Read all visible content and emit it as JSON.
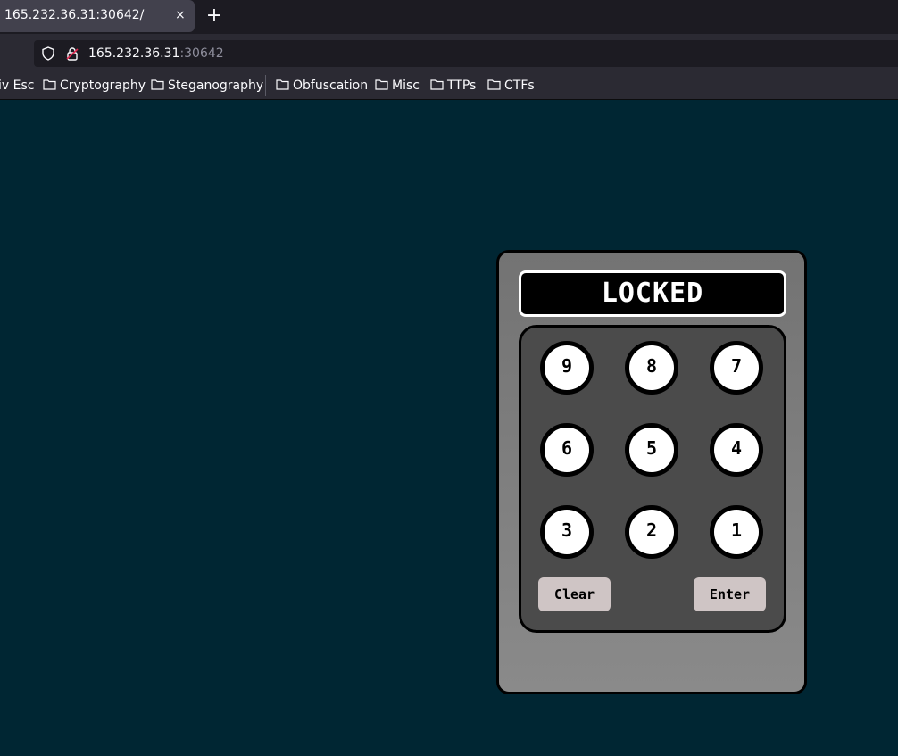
{
  "browser": {
    "tab": {
      "title": "165.232.36.31:30642/",
      "close_glyph": "×"
    },
    "new_tab_glyph": "+",
    "url": {
      "host": "165.232.36.31",
      "port": ":30642"
    },
    "bookmarks": [
      {
        "label": "iv Esc"
      },
      {
        "label": "Cryptography"
      },
      {
        "label": "Steganography"
      },
      {
        "label": "Obfuscation"
      },
      {
        "label": "Misc"
      },
      {
        "label": "TTPs"
      },
      {
        "label": "CTFs"
      }
    ]
  },
  "keypad": {
    "display": "LOCKED",
    "keys": [
      "9",
      "8",
      "7",
      "6",
      "5",
      "4",
      "3",
      "2",
      "1"
    ],
    "clear_label": "Clear",
    "enter_label": "Enter"
  },
  "colors": {
    "page_background": "#002633",
    "device_body": "#808080",
    "pad_background": "#4b4b4b",
    "action_button": "#cfc5c5"
  }
}
